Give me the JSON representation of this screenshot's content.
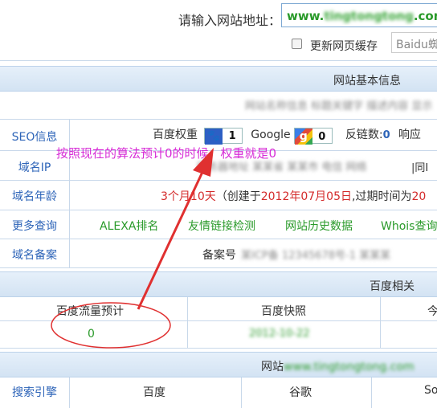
{
  "header": {
    "url_label": "请输入网站地址：",
    "url_prefix": "www.",
    "url_middle": "tingtongtong",
    "url_suffix": ".com",
    "refresh_cache_label": "更新网页缓存",
    "engine_select": "Baidu蜘"
  },
  "basic_info": {
    "title": "网站基本信息",
    "blurred_line": "网站名称信息 标题关键字 描述内容 显示",
    "rows": {
      "seo": {
        "label": "SEO信息",
        "baidu_weight_label": "百度权重",
        "baidu_weight_value": "1",
        "google_label": "Google",
        "google_value": "0",
        "backlinks_label": "反链数:",
        "backlinks_value": "0",
        "response_label": "响应"
      },
      "ip": {
        "label": "域名IP",
        "blurred": "服务器地址 某某省 某某市 电信 网络",
        "suffix": "|同I"
      },
      "age": {
        "label": "域名年龄",
        "age_text": "3个月10天",
        "created_prefix": "（创建于",
        "created_date": "2012年07月05日",
        "expire_text": ",过期时间为",
        "expire_cut": "20"
      },
      "more": {
        "label": "更多查询",
        "links": [
          "ALEXA排名",
          "友情链接检测",
          "网站历史数据",
          "Whois查询"
        ]
      },
      "icp": {
        "label": "域名备案",
        "prefix": "备案号",
        "blurred": "某ICP备 12345678号-1 某某某"
      }
    }
  },
  "annotation": "按照现在的算法预计0的时候，权重就是0",
  "baidu": {
    "title": "百度相关",
    "col_traffic": "百度流量预计",
    "col_snapshot": "百度快照",
    "col_today": "今",
    "traffic_value": "0",
    "snapshot_value": "2012-10-22"
  },
  "website_section": {
    "title_prefix": "网站",
    "blurred_url": "www.tingtongtong.com",
    "col_engine": "搜索引擎",
    "col_baidu": "百度",
    "col_google": "谷歌",
    "col_so": "So"
  },
  "colors": {
    "bar_bg": "#dbe8f6",
    "label_blue": "#2d64b8",
    "link_green": "#2a9a2a",
    "date_red": "#d42b2b",
    "annotation_magenta": "#d62bd6",
    "arrow_red": "#e03030"
  }
}
